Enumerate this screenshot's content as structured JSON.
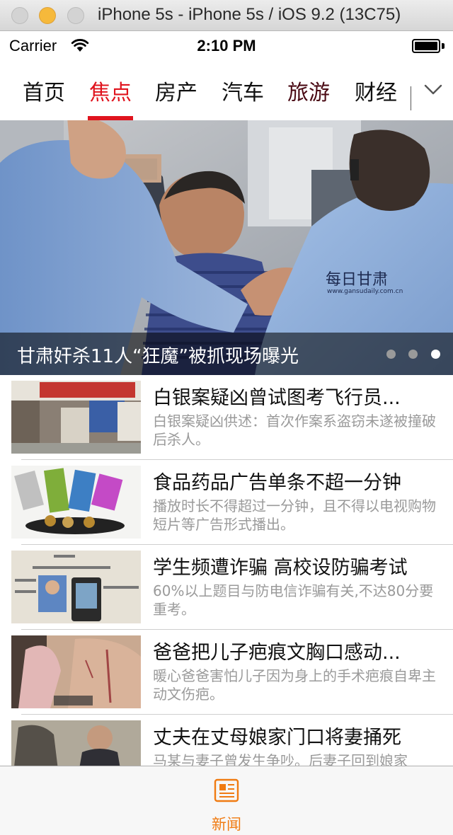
{
  "window": {
    "title": "iPhone 5s - iPhone 5s / iOS 9.2 (13C75)"
  },
  "status_bar": {
    "carrier": "Carrier",
    "time": "2:10 PM",
    "battery_level": 1.0
  },
  "channels": {
    "tabs": [
      {
        "label": "首页",
        "state": "normal"
      },
      {
        "label": "焦点",
        "state": "active"
      },
      {
        "label": "房产",
        "state": "normal"
      },
      {
        "label": "汽车",
        "state": "normal"
      },
      {
        "label": "旅游",
        "state": "dark"
      },
      {
        "label": "财经",
        "state": "normal"
      }
    ],
    "more_icon": "chevron-down-icon"
  },
  "banner": {
    "caption": "甘肃奸杀11人“狂魔”被抓现场曝光",
    "watermark": "每日甘肃",
    "watermark_url": "www.gansudaily.com.cn",
    "page_count": 3,
    "active_page": 3
  },
  "news": [
    {
      "title": "白银案疑凶曾试图考飞行员...",
      "desc": "白银案疑凶供述：首次作案系盗窃未遂被撞破后杀人。"
    },
    {
      "title": "食品药品广告单条不超一分钟",
      "desc": "播放时长不得超过一分钟，且不得以电视购物短片等广告形式播出。"
    },
    {
      "title": "学生频遭诈骗 高校设防骗考试",
      "desc": "60%以上题目与防电信诈骗有关,不达80分要重考。"
    },
    {
      "title": "爸爸把儿子疤痕文胸口感动...",
      "desc": "暖心爸爸害怕儿子因为身上的手术疤痕自卑主动文伤疤。"
    },
    {
      "title": "丈夫在丈母娘家门口将妻捅死",
      "desc": "马某与妻子曾发生争吵。后妻子回到娘家"
    }
  ],
  "tab_bar": {
    "label": "新闻",
    "icon": "newspaper-icon",
    "color": "#f07b12"
  },
  "colors": {
    "accent": "#e0141e",
    "tab_active": "#f07b12"
  }
}
